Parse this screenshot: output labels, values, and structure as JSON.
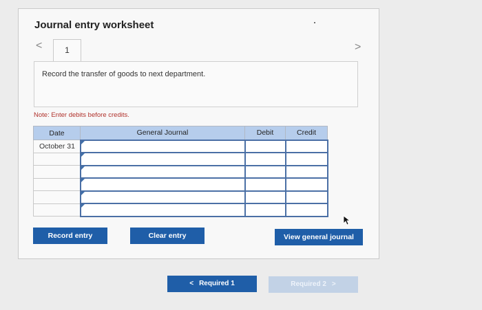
{
  "header": {
    "title": "Journal entry worksheet"
  },
  "tabs": [
    {
      "label": "1"
    }
  ],
  "nav": {
    "prev_glyph": "<",
    "next_glyph": ">"
  },
  "instruction": {
    "text": "Record the transfer of goods to next department."
  },
  "note": {
    "text": "Note: Enter debits before credits."
  },
  "table": {
    "columns": [
      "Date",
      "General Journal",
      "Debit",
      "Credit"
    ],
    "rows": [
      {
        "date": "October 31",
        "general_journal": "",
        "debit": "",
        "credit": ""
      },
      {
        "date": "",
        "general_journal": "",
        "debit": "",
        "credit": ""
      },
      {
        "date": "",
        "general_journal": "",
        "debit": "",
        "credit": ""
      },
      {
        "date": "",
        "general_journal": "",
        "debit": "",
        "credit": ""
      },
      {
        "date": "",
        "general_journal": "",
        "debit": "",
        "credit": ""
      },
      {
        "date": "",
        "general_journal": "",
        "debit": "",
        "credit": ""
      }
    ]
  },
  "buttons": {
    "record": "Record entry",
    "clear": "Clear entry",
    "view": "View general journal"
  },
  "pager": {
    "prev_label": "Required 1",
    "next_label": "Required 2"
  },
  "colors": {
    "primary": "#1f5ea8",
    "header_blue": "#b6cdec",
    "disabled": "#c2d2e6",
    "note_red": "#b0302a"
  }
}
